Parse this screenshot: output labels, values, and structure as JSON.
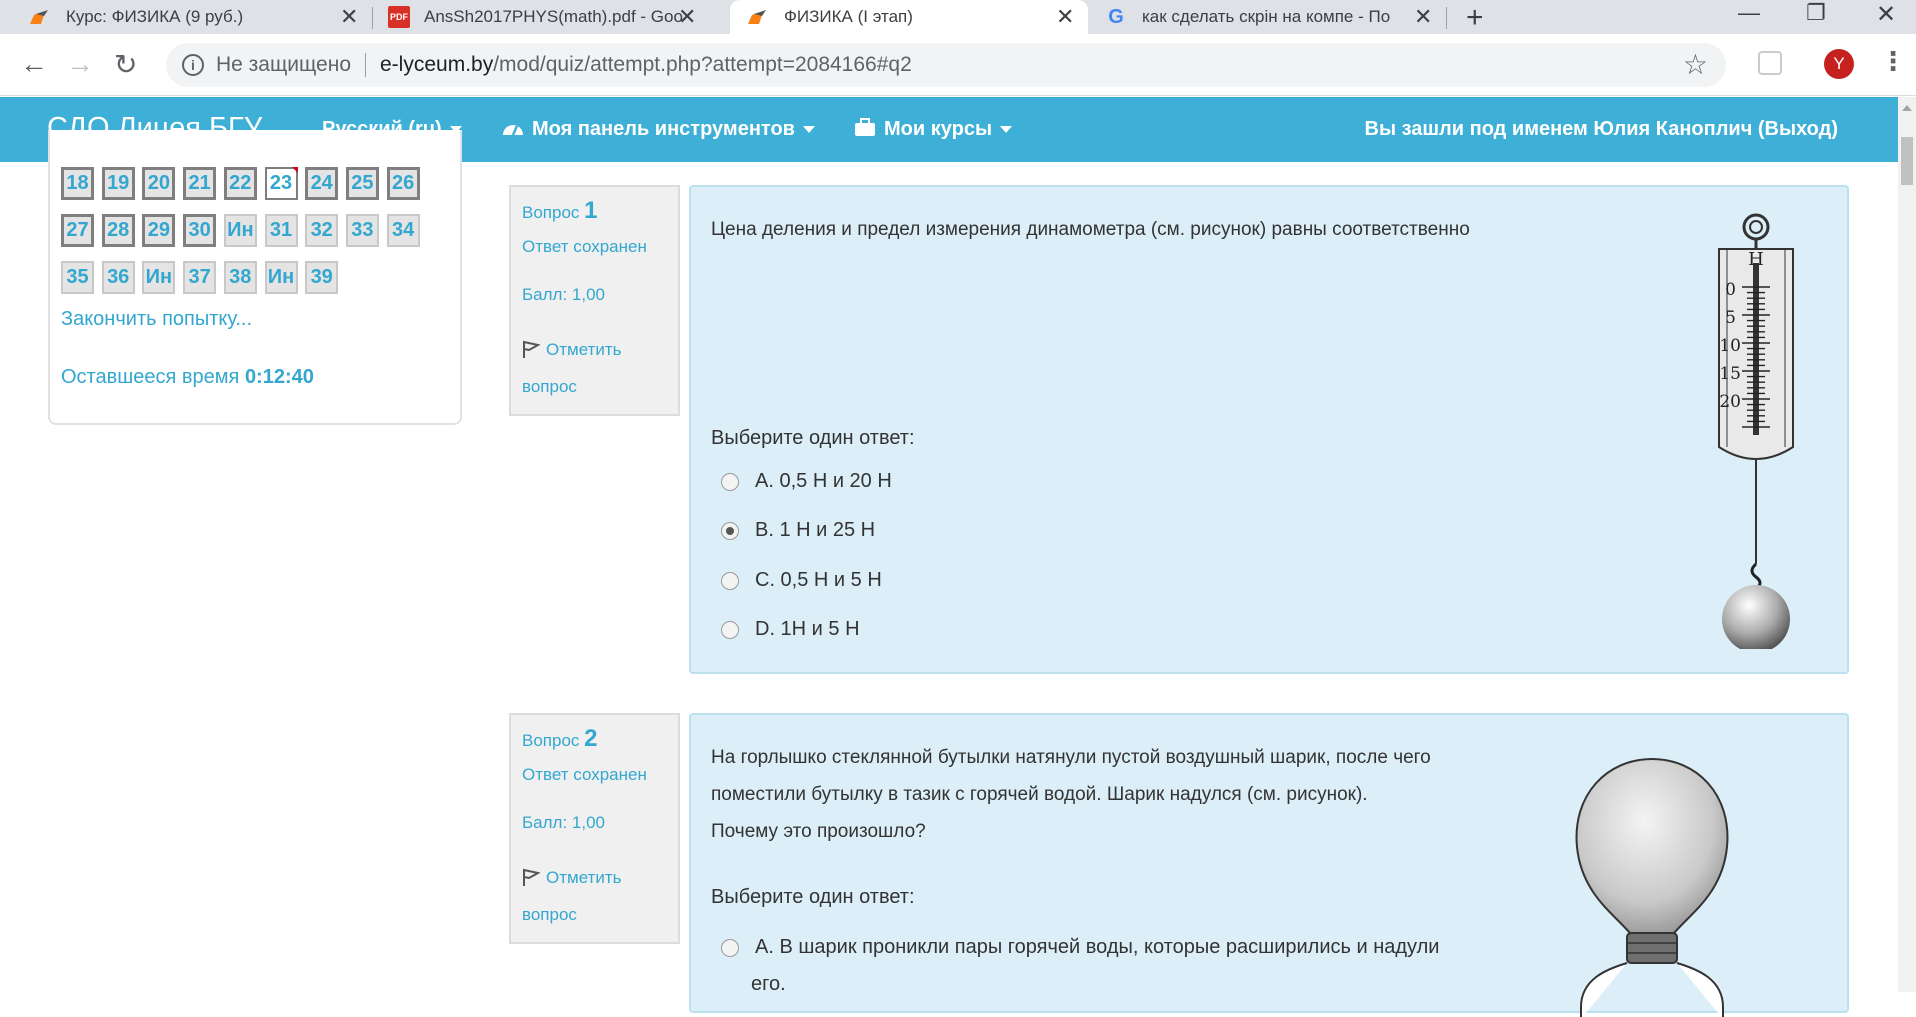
{
  "browser": {
    "tabs": [
      {
        "title": "Курс: ФИЗИКА (9 руб.)",
        "icon": "moodle-icon"
      },
      {
        "title": "AnsSh2017PHYS(math).pdf - Goo",
        "icon": "pdf-icon",
        "badge": "PDF"
      },
      {
        "title": "ФИЗИКА (I этап)",
        "icon": "moodle-icon"
      },
      {
        "title": "как сделать скрін на компе - По",
        "icon": "google-icon",
        "badge": "G"
      }
    ],
    "new_tab": "+",
    "tab_close": "✕",
    "window": {
      "minimize": "—",
      "restore": "❐",
      "close": "✕"
    },
    "nav": {
      "back": "←",
      "forward": "→",
      "reload": "↻"
    },
    "address": {
      "info": "i",
      "security": "Не защищено",
      "domain": "e-lyceum.by",
      "path": "/mod/quiz/attempt.php?attempt=2084166#q2",
      "star": "☆"
    },
    "avatar": "Y",
    "menu": "⋮"
  },
  "site": {
    "brand": "СДО Лицея БГУ",
    "menus": [
      "Русский (ru)",
      "Моя панель инструментов",
      "Мои курсы"
    ],
    "user": "Вы зашли под именем Юлия Каноплич (Выход)"
  },
  "quiz_nav": {
    "rows": [
      [
        "18",
        "19",
        "20",
        "21",
        "22",
        "23",
        "24",
        "25",
        "26"
      ],
      [
        "27",
        "28",
        "29",
        "30",
        "Ин",
        "31",
        "32",
        "33",
        "34"
      ],
      [
        "35",
        "36",
        "Ин",
        "37",
        "38",
        "Ин",
        "39"
      ]
    ],
    "finish": "Закончить попытку...",
    "time_label": "Оставшееся время",
    "time_value": "0:12:40"
  },
  "questions": [
    {
      "label": "Вопрос",
      "num": "1",
      "status": "Ответ сохранен",
      "score": "Балл: 1,00",
      "flag": "Отметить вопрос",
      "text": "Цена деления и предел измерения динамометра (см. рисунок) равны соответственно",
      "choose": "Выберите один ответ:",
      "options": [
        "A. 0,5 Н и 20 Н",
        "B. 1 Н и 25 Н",
        "C. 0,5 Н и 5 Н",
        "D. 1Н и 5 Н"
      ],
      "selected": 1,
      "figure": {
        "unit": "Н",
        "ticks": [
          "0",
          "5",
          "10",
          "15",
          "20"
        ]
      }
    },
    {
      "label": "Вопрос",
      "num": "2",
      "status": "Ответ сохранен",
      "score": "Балл: 1,00",
      "flag": "Отметить вопрос",
      "text_lines": [
        "На горлышко стеклянной бутылки натянули пустой воздушный шарик, после чего",
        "поместили бутылку в тазик с горячей водой. Шарик надулся (см. рисунок).",
        "Почему это произошло?"
      ],
      "choose": "Выберите один ответ:",
      "options_lines": [
        "A. В шарик проникли пары горячей воды, которые расширились и надули",
        "его."
      ]
    }
  ]
}
